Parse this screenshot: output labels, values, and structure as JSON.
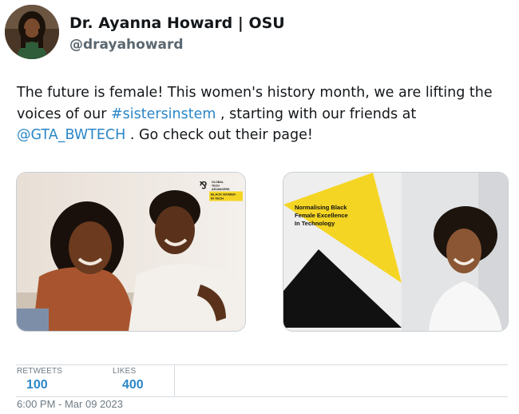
{
  "author": {
    "name": "Dr. Ayanna Howard | OSU",
    "handle": "@drayahoward"
  },
  "tweet": {
    "text_1": "The future is female!  This women's history month, we are lifting the voices of our ",
    "hashtag": "#sistersinstem",
    "text_2": " , starting with our friends at ",
    "mention": "@GTA_BWTECH",
    "text_3": " .  Go check out their page!"
  },
  "media": {
    "image_1": {
      "badge_line_1": "GLOBAL",
      "badge_line_2": "TECH",
      "badge_line_3": "ADVANCERS",
      "badge_line_4": "BLACK WOMEN",
      "badge_line_5": "IN TECH"
    },
    "image_2": {
      "headline_line_1": "Normalising Black",
      "headline_line_2": "Female Excellence",
      "headline_line_3": "In Technology"
    }
  },
  "stats": {
    "retweets_label": "RETWEETS",
    "retweets_count": "100",
    "likes_label": "LIKES",
    "likes_count": "400"
  },
  "timestamp": "6:00 PM - Mar 09 2023",
  "colors": {
    "link": "#2a86c7",
    "accent_yellow": "#f5d524"
  }
}
